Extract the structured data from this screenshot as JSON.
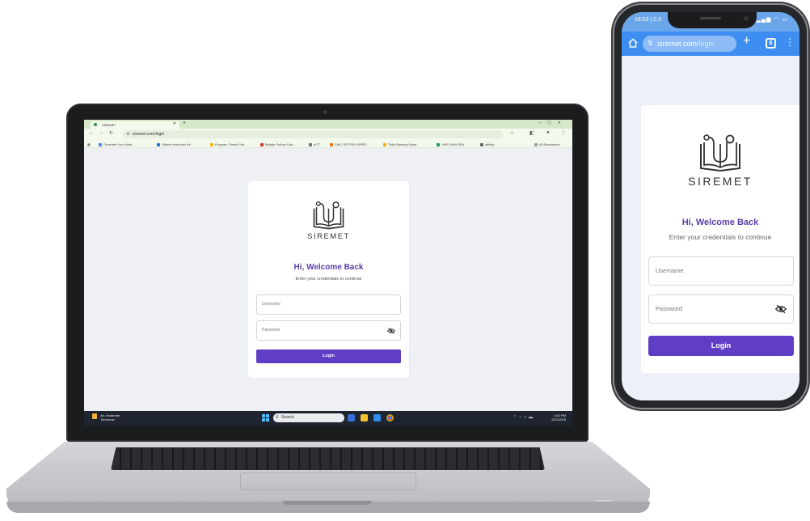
{
  "brand": {
    "name": "SIREMET",
    "accent": "#5f3dc4",
    "title_color": "#5b3ea8"
  },
  "login": {
    "title": "Hi, Welcome Back",
    "subtitle": "Enter your credentials to continue",
    "username_placeholder": "Username",
    "password_placeholder": "Password",
    "submit_label": "Login",
    "password_icon": "eye-off-icon"
  },
  "laptop_browser": {
    "tab_title": "SIREMET",
    "url": "siremet.com/login",
    "bookmarks": [
      "Generate Your Web...",
      "Sistem Informasi Ke...",
      "Program Thesis Pub...",
      "Belajar Python Das...",
      "elTT",
      "SIM | SISTRIN SIRRE...",
      "Tully Masking Syste...",
      "UMS UNIVORA",
      "affinity",
      "All Bookmarks"
    ],
    "taskbar": {
      "weather_title": "Air: Moderate",
      "weather_sub": "Tomorrow",
      "search_label": "Search",
      "clock_time": "4:52 PM",
      "clock_date": "2/21/2025"
    }
  },
  "phone_browser": {
    "status_time": "16:53 | 0,3",
    "url_host": "siremet.com",
    "url_path": "/login",
    "tab_count": "8"
  }
}
